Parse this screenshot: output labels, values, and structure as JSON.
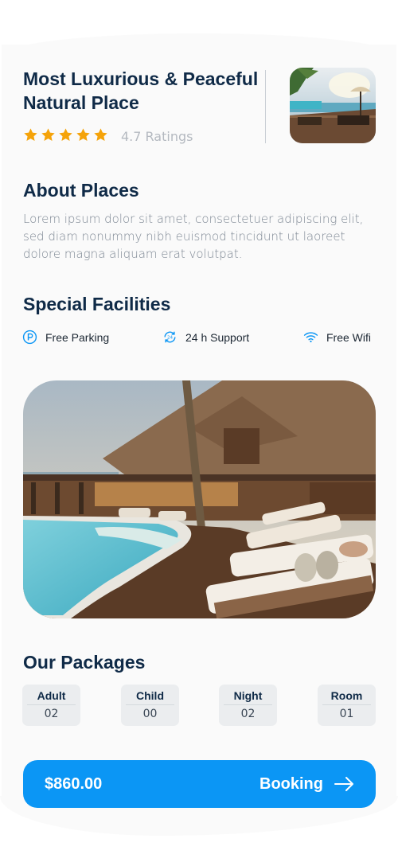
{
  "header": {
    "title": "Most Luxurious & Peaceful Natural Place",
    "rating_stars": 5,
    "rating_text": "4.7 Ratings"
  },
  "about": {
    "title": "About Places",
    "text": "Lorem ipsum dolor sit amet, consectetuer adipiscing elit, sed diam nonummy nibh euismod tincidunt ut laoreet dolore magna aliquam erat volutpat."
  },
  "facilities": {
    "title": "Special Facilities",
    "items": [
      {
        "label": "Free Parking",
        "icon": "parking-icon"
      },
      {
        "label": "24 h Support",
        "icon": "support-24h-icon"
      },
      {
        "label": "Free Wifi",
        "icon": "wifi-icon"
      }
    ]
  },
  "packages": {
    "title": "Our Packages",
    "items": [
      {
        "label": "Adult",
        "value": "02"
      },
      {
        "label": "Child",
        "value": "00"
      },
      {
        "label": "Night",
        "value": "02"
      },
      {
        "label": "Room",
        "value": "01"
      }
    ]
  },
  "booking": {
    "price": "$860.00",
    "label": "Booking",
    "icon": "arrow-right-icon"
  },
  "colors": {
    "accent": "#0b96f5",
    "star": "#f5a30a",
    "heading": "#0f2a47"
  }
}
